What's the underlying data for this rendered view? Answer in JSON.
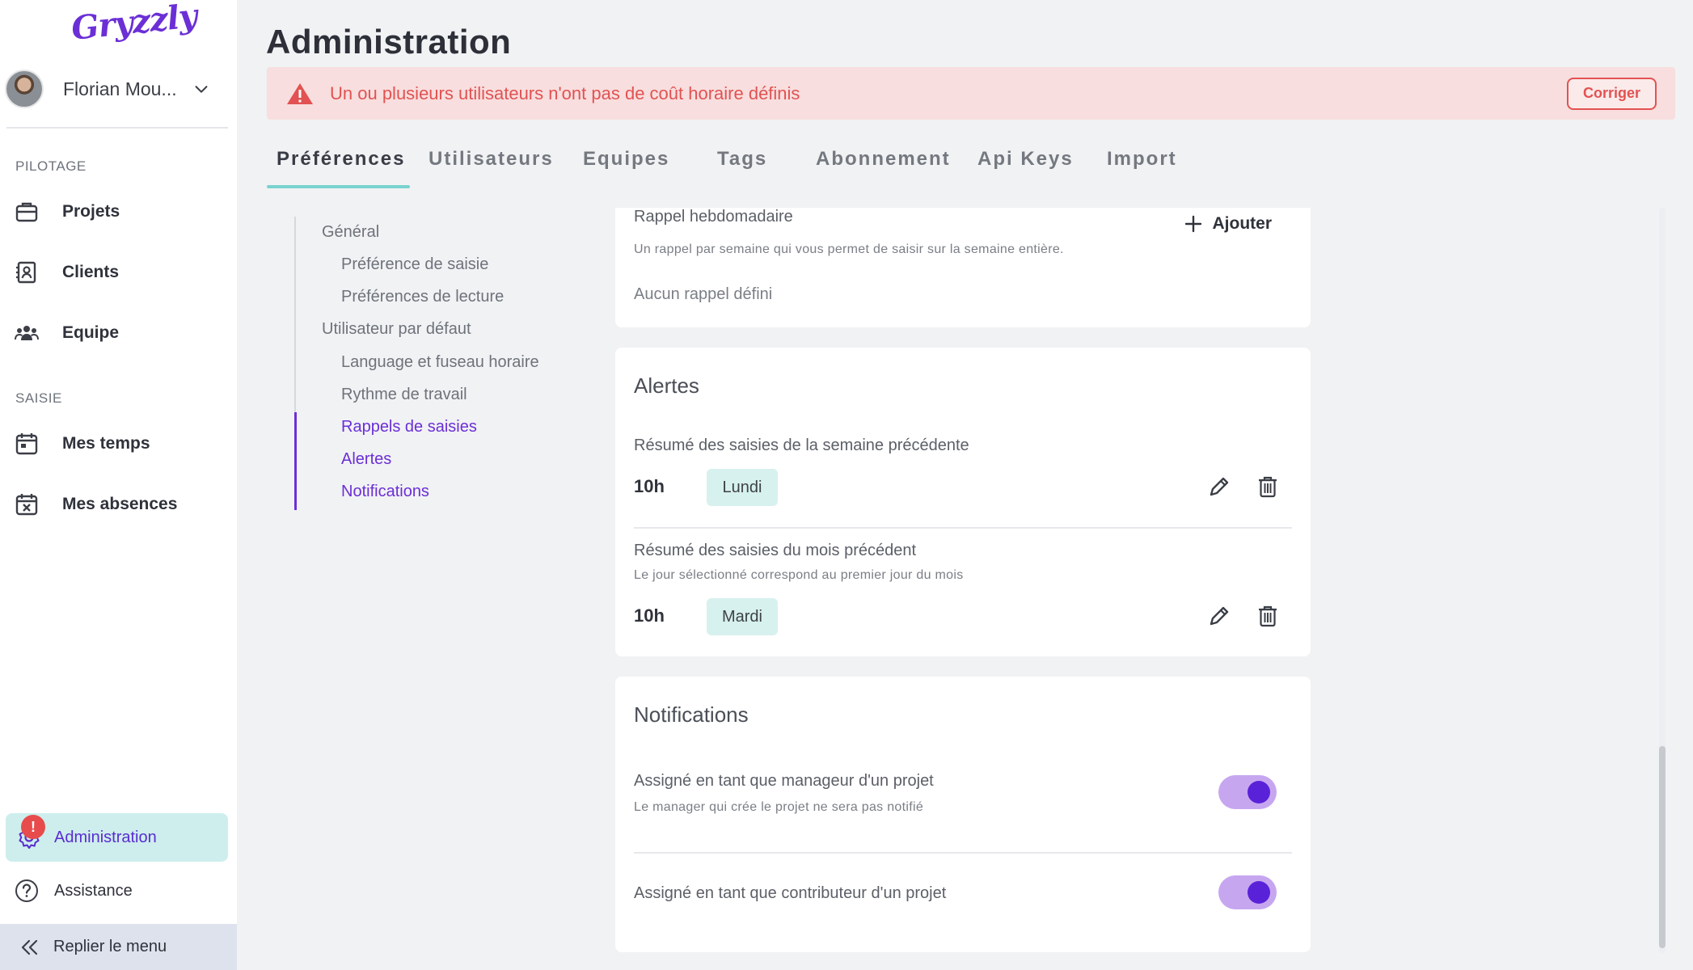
{
  "app": {
    "logo_text": "Gryzzly"
  },
  "user": {
    "name": "Florian Mou..."
  },
  "sidebar": {
    "section_pilotage": "PILOTAGE",
    "pilotage_items": [
      {
        "label": "Projets",
        "icon": "briefcase-icon"
      },
      {
        "label": "Clients",
        "icon": "contact-card-icon"
      },
      {
        "label": "Equipe",
        "icon": "team-icon"
      }
    ],
    "section_saisie": "SAISIE",
    "saisie_items": [
      {
        "label": "Mes temps",
        "icon": "calendar-icon"
      },
      {
        "label": "Mes absences",
        "icon": "calendar-x-icon"
      }
    ],
    "admin_label": "Administration",
    "admin_badge": "!",
    "assist_label": "Assistance",
    "collapse_label": "Replier le menu"
  },
  "header": {
    "title": "Administration",
    "alert_message": "Un ou plusieurs utilisateurs n'ont pas de coût horaire définis",
    "alert_button": "Corriger"
  },
  "tabs": [
    "Préférences",
    "Utilisateurs",
    "Equipes",
    "Tags",
    "Abonnement",
    "Api Keys",
    "Import"
  ],
  "active_tab": "Préférences",
  "subnav": {
    "items": [
      {
        "label": "Général"
      },
      {
        "label": "Préférence de saisie"
      },
      {
        "label": "Préférences de lecture"
      },
      {
        "label": "Utilisateur par défaut"
      },
      {
        "label": "Language et fuseau horaire"
      },
      {
        "label": "Rythme de travail"
      },
      {
        "label": "Rappels de saisies"
      },
      {
        "label": "Alertes"
      },
      {
        "label": "Notifications"
      }
    ]
  },
  "weekly_reminder": {
    "title": "Rappel hebdomadaire",
    "add_label": "Ajouter",
    "description": "Un rappel par semaine qui vous permet de saisir sur la semaine entière.",
    "empty": "Aucun rappel défini"
  },
  "alerts": {
    "title": "Alertes",
    "items": [
      {
        "label": "Résumé des saisies de la semaine précédente",
        "time": "10h",
        "day": "Lundi"
      },
      {
        "label": "Résumé des saisies du mois précédent",
        "sub": "Le jour sélectionné correspond au premier jour du mois",
        "time": "10h",
        "day": "Mardi"
      }
    ]
  },
  "notifications": {
    "title": "Notifications",
    "items": [
      {
        "label": "Assigné en tant que manageur d'un projet",
        "sub": "Le manager qui crée le projet ne sera pas notifié",
        "enabled": true
      },
      {
        "label": "Assigné en tant que contributeur d'un projet",
        "enabled": true
      }
    ]
  },
  "colors": {
    "accent": "#6b2fd6",
    "teal": "#79d3cf",
    "alert": "#e25252",
    "alert_bg": "#f8dede"
  }
}
